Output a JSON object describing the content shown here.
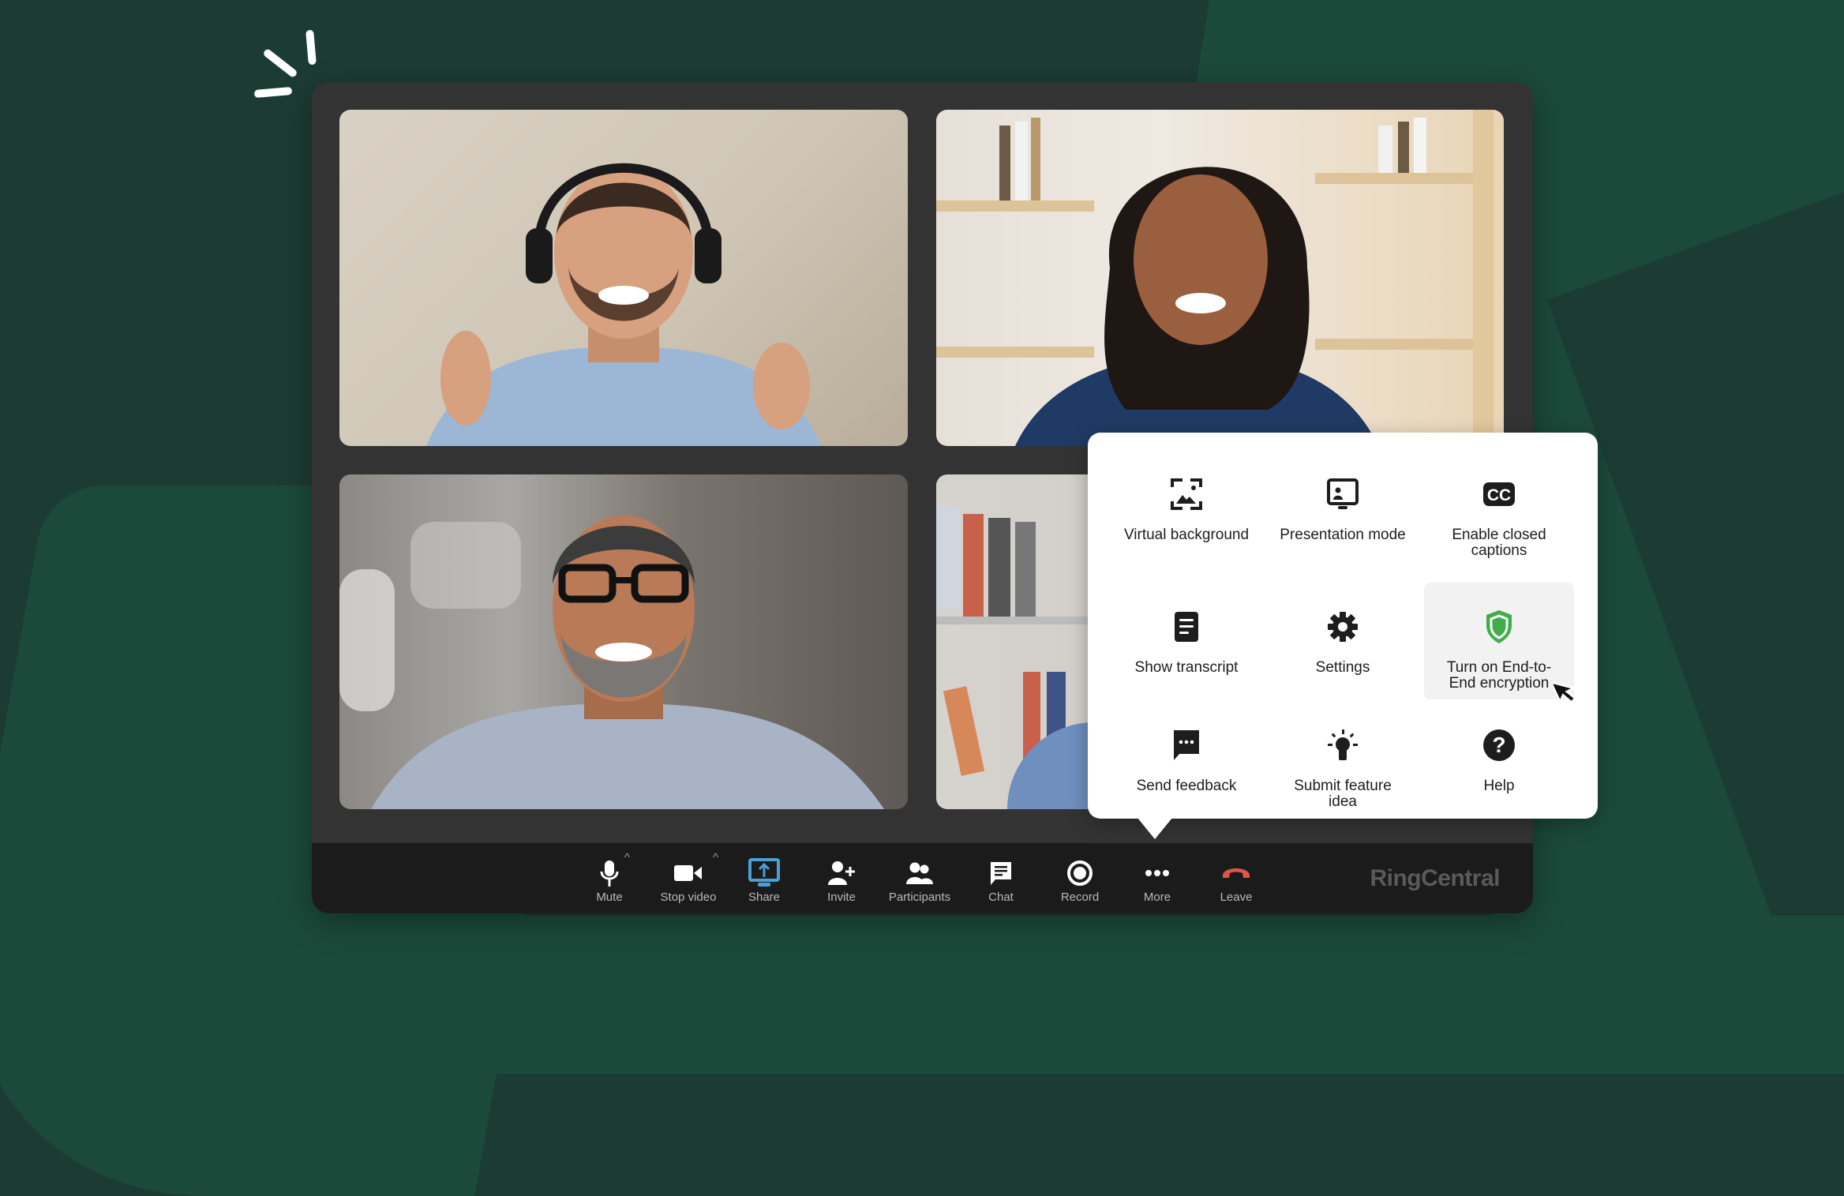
{
  "brand": {
    "logo_text": "RingCentral",
    "accent_share": "#4a9fd8",
    "leave_color": "#d9564a",
    "encryption_green": "#3fae49"
  },
  "video_tiles": [
    {
      "participant": "man-with-headset",
      "position": "top-left"
    },
    {
      "participant": "woman-smiling",
      "position": "top-right"
    },
    {
      "participant": "man-with-glasses",
      "position": "bottom-left"
    },
    {
      "participant": "partially-hidden",
      "position": "bottom-right"
    }
  ],
  "toolbar": {
    "items": [
      {
        "label": "Mute",
        "icon": "microphone-icon",
        "has_caret": true
      },
      {
        "label": "Stop video",
        "icon": "video-camera-icon",
        "has_caret": true
      },
      {
        "label": "Share",
        "icon": "share-screen-icon",
        "active": true
      },
      {
        "label": "Invite",
        "icon": "add-user-icon"
      },
      {
        "label": "Participants",
        "icon": "participants-icon"
      },
      {
        "label": "Chat",
        "icon": "chat-icon"
      },
      {
        "label": "Record",
        "icon": "record-icon"
      },
      {
        "label": "More",
        "icon": "more-dots-icon",
        "open": true
      },
      {
        "label": "Leave",
        "icon": "hang-up-icon"
      }
    ]
  },
  "more_menu": {
    "items": [
      {
        "label": "Virtual background",
        "icon": "virtual-background-icon"
      },
      {
        "label": "Presentation mode",
        "icon": "presentation-mode-icon"
      },
      {
        "label": "Enable closed captions",
        "icon": "closed-captions-icon"
      },
      {
        "label": "Show transcript",
        "icon": "transcript-icon"
      },
      {
        "label": "Settings",
        "icon": "gear-icon"
      },
      {
        "label": "Turn on End-to-End encryption",
        "icon": "shield-icon",
        "hovered": true
      },
      {
        "label": "Send feedback",
        "icon": "feedback-icon"
      },
      {
        "label": "Submit feature idea",
        "icon": "lightbulb-icon"
      },
      {
        "label": "Help",
        "icon": "help-icon"
      }
    ]
  }
}
